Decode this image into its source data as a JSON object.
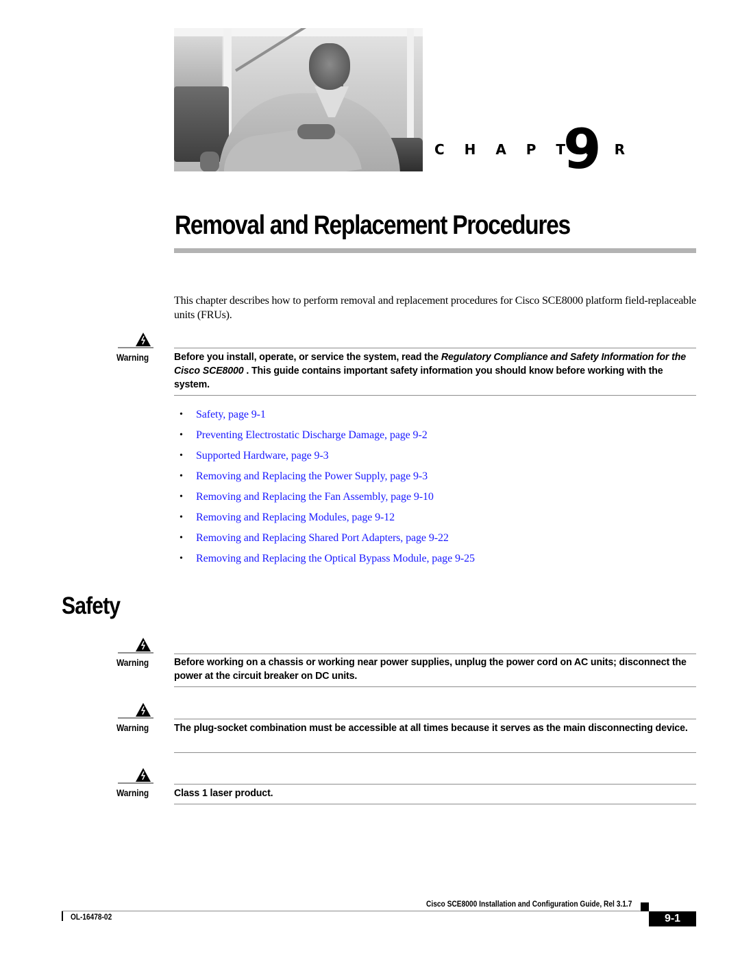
{
  "chapter": {
    "label": "C H A P T E R",
    "number": "9",
    "title": "Removal and Replacement Procedures",
    "photo": "chapter-cover-photo"
  },
  "intro": "This chapter describes how to perform removal and replacement procedures for Cisco SCE8000 platform field-replaceable units (FRUs).",
  "warning_label": "Warning",
  "warnings": [
    {
      "parts": [
        {
          "text": "Before you install, operate, or service the system, read the ",
          "italic": false
        },
        {
          "text": "Regulatory Compliance and Safety Information for the Cisco SCE8000",
          "italic": true
        },
        {
          "text": " . This guide contains important safety information you should know before working with the system.",
          "italic": false
        }
      ]
    },
    {
      "parts": [
        {
          "text": "Before working on a chassis or working near power supplies, unplug the power cord on AC units; disconnect the power at the circuit breaker on DC units.",
          "italic": false
        }
      ]
    },
    {
      "parts": [
        {
          "text": "The plug-socket combination must be accessible at all times because it serves as the main disconnecting device.",
          "italic": false
        }
      ]
    },
    {
      "parts": [
        {
          "text": "Class 1 laser product.",
          "italic": false
        }
      ]
    }
  ],
  "toc": [
    {
      "bullet": "•",
      "label": "Safety, page 9-1"
    },
    {
      "bullet": "•",
      "label": "Preventing Electrostatic Discharge Damage, page 9-2"
    },
    {
      "bullet": "•",
      "label": "Supported Hardware, page 9-3"
    },
    {
      "bullet": "•",
      "label": "Removing and Replacing the Power Supply, page 9-3"
    },
    {
      "bullet": "•",
      "label": "Removing and Replacing the Fan Assembly, page 9-10"
    },
    {
      "bullet": "•",
      "label": "Removing and Replacing Modules, page 9-12"
    },
    {
      "bullet": "•",
      "label": "Removing and Replacing Shared Port Adapters, page 9-22"
    },
    {
      "bullet": "•",
      "label": "Removing and Replacing the Optical Bypass Module, page 9-25"
    }
  ],
  "section": {
    "title": "Safety"
  },
  "footer": {
    "guide_title": "Cisco SCE8000 Installation and Configuration Guide, Rel 3.1.7",
    "doc_number": "OL-16478-02",
    "page_number": "9-1"
  },
  "colors": {
    "link": "#1a1aff",
    "rule": "#b3b3b3",
    "text": "#000000"
  }
}
